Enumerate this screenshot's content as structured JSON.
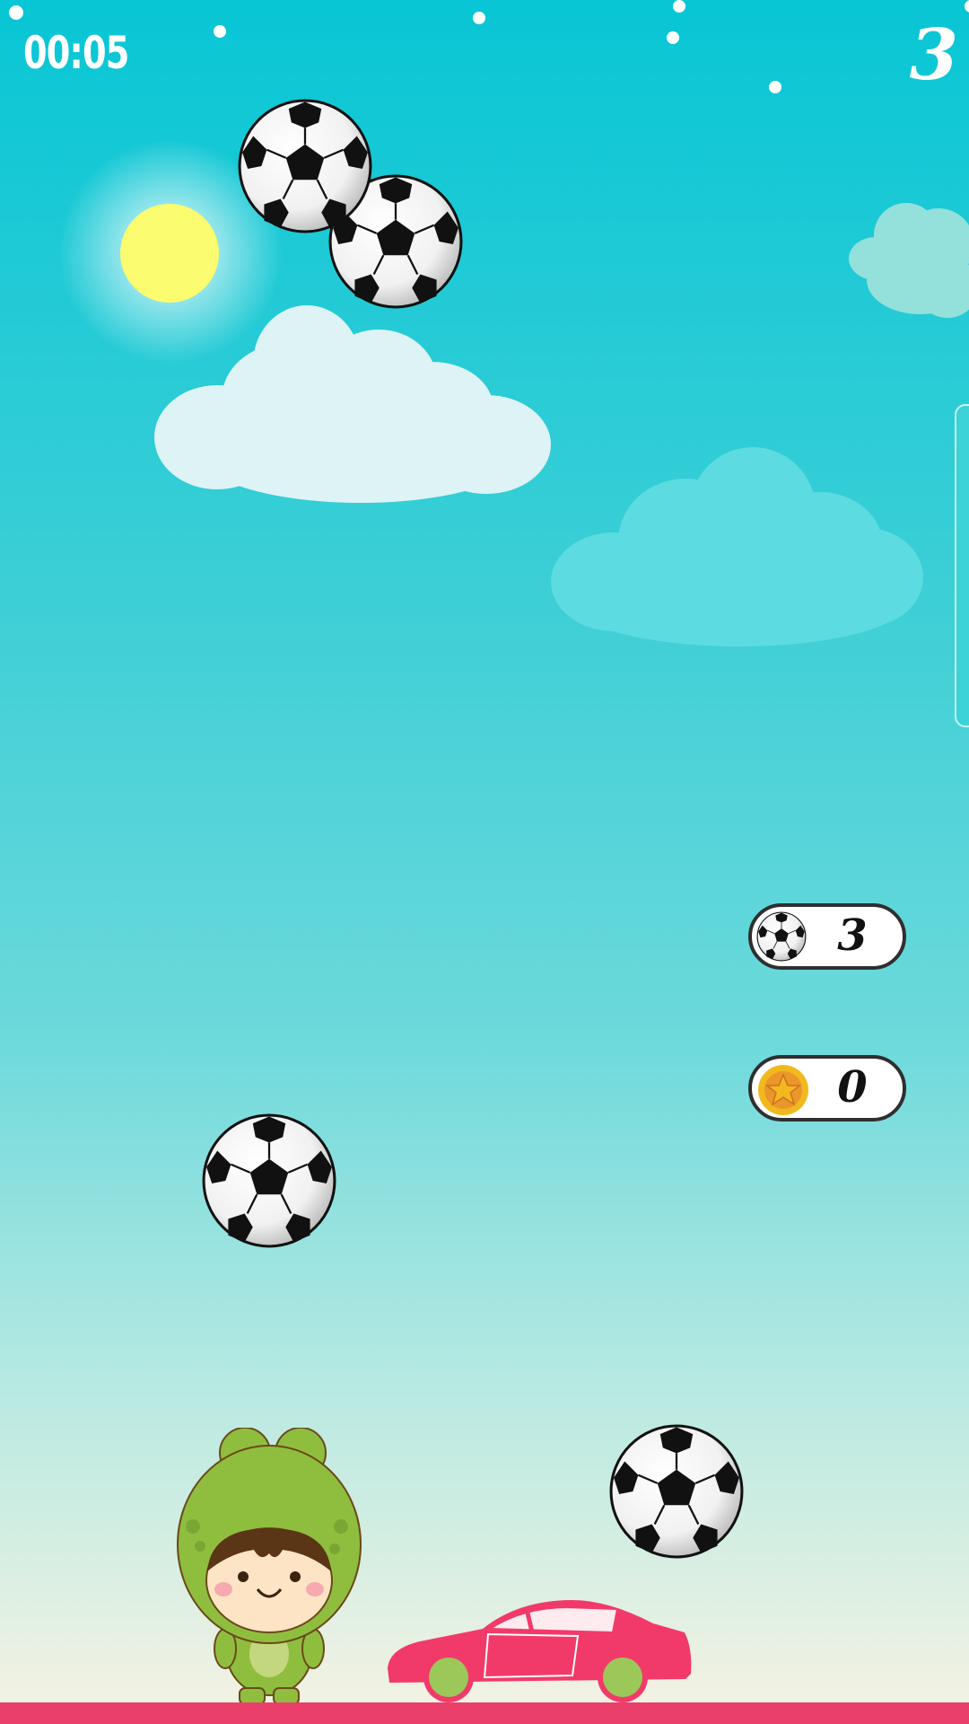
{
  "hud": {
    "timer": "00:05",
    "score": "3"
  },
  "counters": {
    "balls": {
      "icon": "soccer-ball-icon",
      "value": "3"
    },
    "coins": {
      "icon": "star-coin-icon",
      "value": "0"
    }
  },
  "colors": {
    "sky_top": "#08c6d5",
    "sky_bottom": "#f6f3e3",
    "ground": "#ea3f6a",
    "car": "#f23a6a",
    "frog_costume": "#8fbe3f",
    "sun": "#fbfc6f"
  },
  "scene": {
    "character": "frog-costume-girl",
    "vehicle": "pink-sports-car",
    "falling_balls": 4
  }
}
